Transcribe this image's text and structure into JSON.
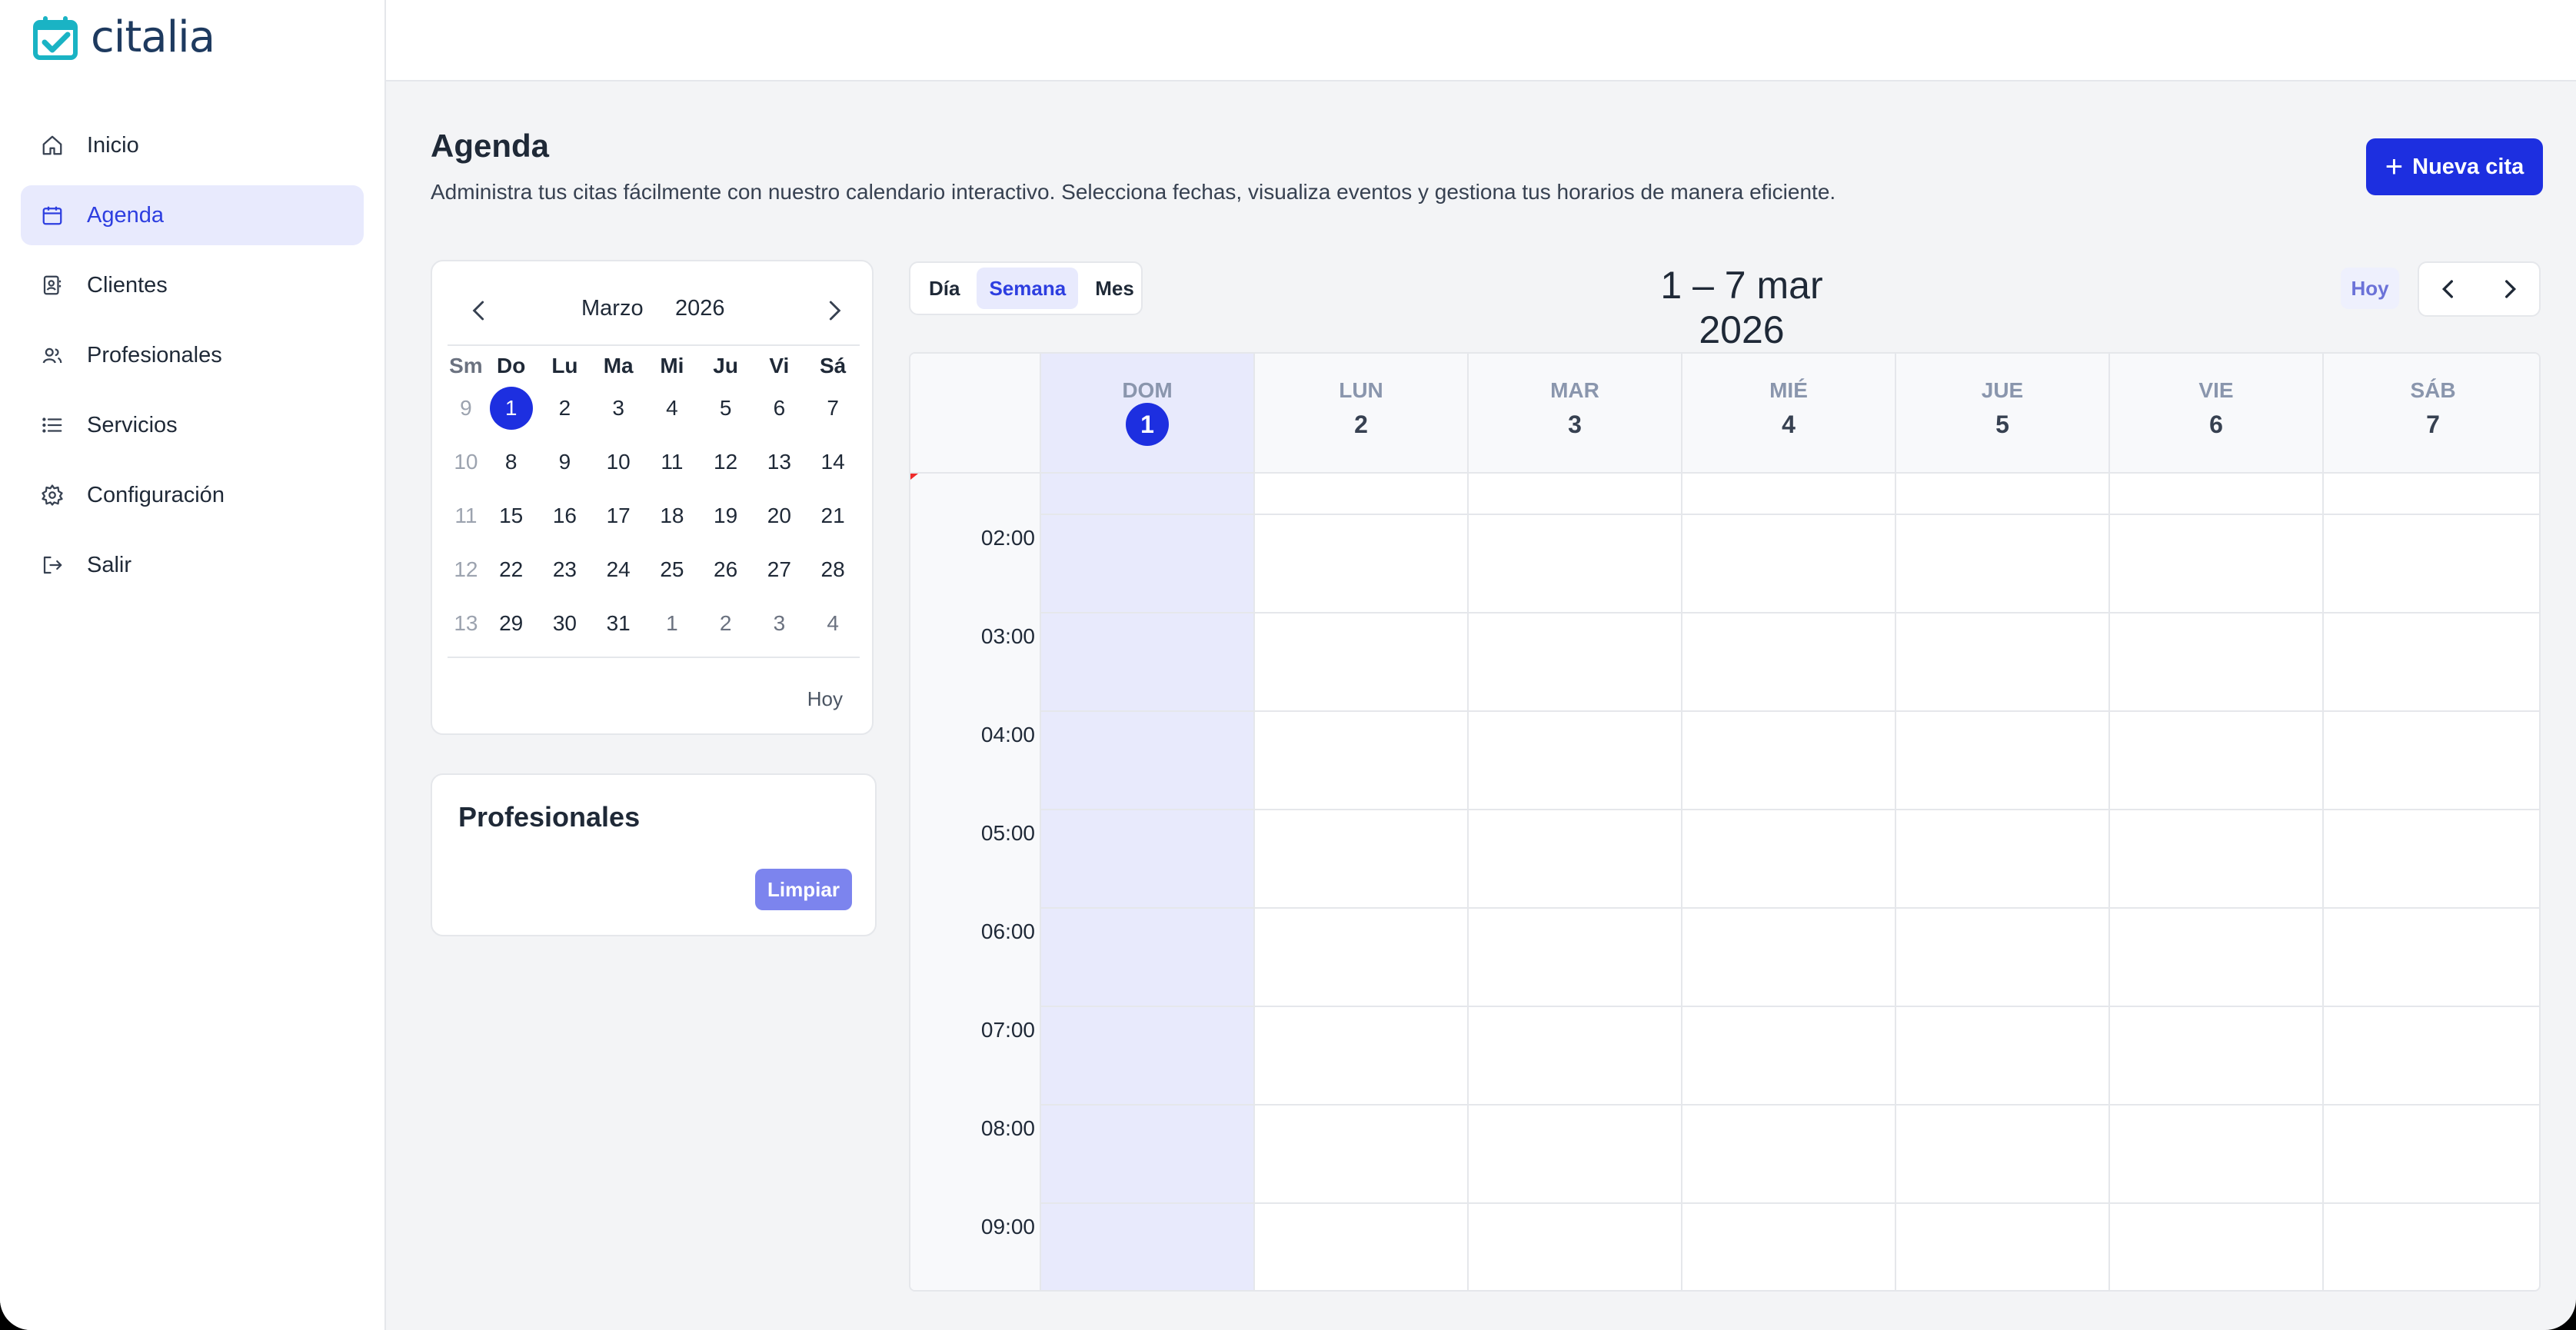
{
  "brand": {
    "name": "citalia",
    "color": "#1ab3c4"
  },
  "sidebar": {
    "items": [
      {
        "label": "Inicio",
        "icon": "home-icon",
        "active": false
      },
      {
        "label": "Agenda",
        "icon": "calendar-icon",
        "active": true
      },
      {
        "label": "Clientes",
        "icon": "contacts-icon",
        "active": false
      },
      {
        "label": "Profesionales",
        "icon": "users-icon",
        "active": false
      },
      {
        "label": "Servicios",
        "icon": "list-icon",
        "active": false
      },
      {
        "label": "Configuración",
        "icon": "gear-icon",
        "active": false
      },
      {
        "label": "Salir",
        "icon": "logout-icon",
        "active": false
      }
    ]
  },
  "header": {
    "title": "Agenda",
    "description": "Administra tus citas fácilmente con nuestro calendario interactivo. Selecciona fechas, visualiza eventos y gestiona tus horarios de manera eficiente.",
    "new_button": "Nueva cita"
  },
  "mini_calendar": {
    "month": "Marzo",
    "year": "2026",
    "headers": [
      "Sm",
      "Do",
      "Lu",
      "Ma",
      "Mi",
      "Ju",
      "Vi",
      "Sá"
    ],
    "weeks": [
      {
        "wk": "9",
        "days": [
          "1",
          "2",
          "3",
          "4",
          "5",
          "6",
          "7"
        ]
      },
      {
        "wk": "10",
        "days": [
          "8",
          "9",
          "10",
          "11",
          "12",
          "13",
          "14"
        ]
      },
      {
        "wk": "11",
        "days": [
          "15",
          "16",
          "17",
          "18",
          "19",
          "20",
          "21"
        ]
      },
      {
        "wk": "12",
        "days": [
          "22",
          "23",
          "24",
          "25",
          "26",
          "27",
          "28"
        ]
      },
      {
        "wk": "13",
        "days": [
          "29",
          "30",
          "31",
          "1",
          "2",
          "3",
          "4"
        ]
      }
    ],
    "selected": "1",
    "today_label": "Hoy"
  },
  "professionals": {
    "title": "Profesionales",
    "clear_button": "Limpiar"
  },
  "toolbar": {
    "views": [
      "Día",
      "Semana",
      "Mes"
    ],
    "active_view": "Semana",
    "range": "1 – 7 mar 2026",
    "today_button": "Hoy"
  },
  "week": {
    "days": [
      {
        "name": "DOM",
        "num": "1",
        "today": true
      },
      {
        "name": "LUN",
        "num": "2",
        "today": false
      },
      {
        "name": "MAR",
        "num": "3",
        "today": false
      },
      {
        "name": "MIÉ",
        "num": "4",
        "today": false
      },
      {
        "name": "JUE",
        "num": "5",
        "today": false
      },
      {
        "name": "VIE",
        "num": "6",
        "today": false
      },
      {
        "name": "SÁB",
        "num": "7",
        "today": false
      }
    ],
    "hours": [
      "02:00",
      "03:00",
      "04:00",
      "05:00",
      "06:00",
      "07:00",
      "08:00",
      "09:00"
    ]
  },
  "colors": {
    "accent": "#1d2fe0",
    "active_bg": "#e8eafd",
    "now_indicator": "#ef2b2b"
  }
}
